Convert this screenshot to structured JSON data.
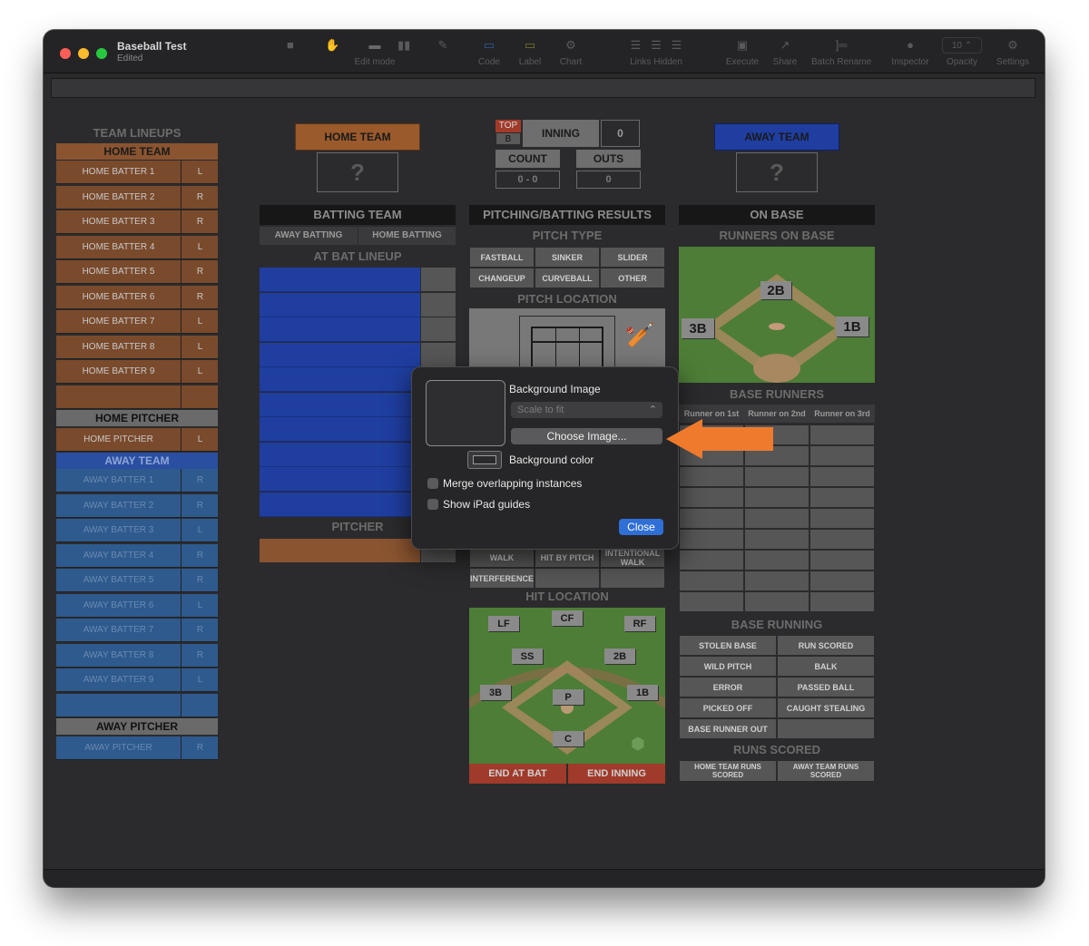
{
  "window": {
    "title": "Baseball Test",
    "subtitle": "Edited"
  },
  "toolbar": {
    "items": [
      {
        "label": "",
        "icon": "video-icon"
      },
      {
        "label": "",
        "icon": "hand-icon"
      },
      {
        "label": "Edit mode",
        "icon": "edit-mode-icon"
      },
      {
        "label": "",
        "icon": "bar-chart-icon"
      },
      {
        "label": "",
        "icon": "pencil-icon"
      },
      {
        "label": "Code",
        "icon": "code-icon"
      },
      {
        "label": "Label",
        "icon": "label-icon"
      },
      {
        "label": "Chart",
        "icon": "chart-icon"
      },
      {
        "label": "Links Hidden",
        "icon": "links-icon"
      },
      {
        "label": "Execute",
        "icon": "execute-icon"
      },
      {
        "label": "Share",
        "icon": "share-icon"
      },
      {
        "label": "Batch Rename",
        "icon": "batch-rename-icon"
      },
      {
        "label": "Inspector",
        "icon": "info-icon"
      },
      {
        "label": "Opacity",
        "icon": "opacity-stepper"
      },
      {
        "label": "Settings",
        "icon": "gear-icon"
      }
    ],
    "opacity_value": "10"
  },
  "lineups": {
    "title": "TEAM LINEUPS",
    "home_team": "HOME TEAM",
    "home_batters": [
      {
        "name": "HOME BATTER 1",
        "hand": "L"
      },
      {
        "name": "HOME BATTER 2",
        "hand": "R"
      },
      {
        "name": "HOME BATTER 3",
        "hand": "R"
      },
      {
        "name": "HOME BATTER 4",
        "hand": "L"
      },
      {
        "name": "HOME BATTER 5",
        "hand": "R"
      },
      {
        "name": "HOME BATTER 6",
        "hand": "R"
      },
      {
        "name": "HOME BATTER 7",
        "hand": "L"
      },
      {
        "name": "HOME BATTER 8",
        "hand": "L"
      },
      {
        "name": "HOME BATTER 9",
        "hand": "L"
      }
    ],
    "home_pitcher_label": "HOME PITCHER",
    "home_pitcher": {
      "name": "HOME PITCHER",
      "hand": "L"
    },
    "away_team": "AWAY TEAM",
    "away_batters": [
      {
        "name": "AWAY BATTER 1",
        "hand": "R"
      },
      {
        "name": "AWAY BATTER 2",
        "hand": "R"
      },
      {
        "name": "AWAY BATTER 3",
        "hand": "L"
      },
      {
        "name": "AWAY BATTER 4",
        "hand": "R"
      },
      {
        "name": "AWAY BATTER 5",
        "hand": "R"
      },
      {
        "name": "AWAY BATTER 6",
        "hand": "L"
      },
      {
        "name": "AWAY BATTER 7",
        "hand": "R"
      },
      {
        "name": "AWAY BATTER 8",
        "hand": "R"
      },
      {
        "name": "AWAY BATTER 9",
        "hand": "L"
      }
    ],
    "away_pitcher_label": "AWAY PITCHER",
    "away_pitcher": {
      "name": "AWAY PITCHER",
      "hand": "R"
    }
  },
  "scoreboard": {
    "home_team": "HOME TEAM",
    "away_team": "AWAY TEAM",
    "logo_placeholder": "?",
    "top": "TOP",
    "bottom": "B",
    "inning_label": "INNING",
    "inning_value": "0",
    "count_label": "COUNT",
    "count_value": "0 - 0",
    "outs_label": "OUTS",
    "outs_value": "0"
  },
  "batting": {
    "header": "BATTING TEAM",
    "away_batting": "AWAY BATTING",
    "home_batting": "HOME BATTING",
    "at_bat_lineup": "AT BAT LINEUP",
    "pitcher": "PITCHER"
  },
  "results": {
    "header": "PITCHING/BATTING RESULTS",
    "pitch_type": "PITCH TYPE",
    "pitch_types": [
      "FASTBALL",
      "SINKER",
      "SLIDER",
      "CHANGEUP",
      "CURVEBALL",
      "OTHER"
    ],
    "pitch_location": "PITCH LOCATION",
    "partial_results": [
      "WALK",
      "HIT BY PITCH",
      "INTENTIONAL WALK",
      "INTERFERENCE"
    ],
    "hit_location": "HIT LOCATION",
    "field_positions": [
      "LF",
      "CF",
      "RF",
      "SS",
      "2B",
      "3B",
      "P",
      "1B",
      "C"
    ],
    "end_at_bat": "END AT BAT",
    "end_inning": "END INNING"
  },
  "onbase": {
    "header": "ON BASE",
    "runners_on_base": "RUNNERS ON BASE",
    "bases": [
      "2B",
      "3B",
      "1B"
    ],
    "base_runners": "BASE RUNNERS",
    "runner_cols": [
      "Runner on 1st",
      "Runner on 2nd",
      "Runner on 3rd"
    ],
    "base_running": "BASE RUNNING",
    "base_running_items": [
      "STOLEN BASE",
      "RUN SCORED",
      "WILD PITCH",
      "BALK",
      "ERROR",
      "PASSED BALL",
      "PICKED OFF",
      "CAUGHT STEALING",
      "BASE RUNNER OUT",
      ""
    ],
    "runs_scored": "RUNS SCORED",
    "home_runs_scored": "HOME TEAM RUNS SCORED",
    "away_runs_scored": "AWAY TEAM RUNS SCORED"
  },
  "popover": {
    "background_image": "Background Image",
    "scale_option": "Scale to fit",
    "choose_image": "Choose Image...",
    "background_color": "Background color",
    "merge_overlapping": "Merge overlapping instances",
    "show_ipad_guides": "Show iPad guides",
    "close": "Close"
  },
  "colors": {
    "accent_blue": "#2f6fd6",
    "arrow_orange": "#f07a2c",
    "home_orange": "#7a4a2c",
    "away_blue": "#2e5a8e",
    "field_green": "#4a7a34"
  }
}
